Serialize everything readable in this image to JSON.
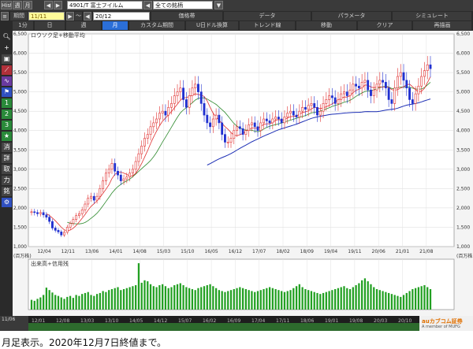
{
  "toolbar": {
    "tabs_left": [
      "Hist",
      "週",
      "月"
    ],
    "symbol": "4901/T 富士フイルム",
    "universe": "全ての銘柄",
    "col_labels": [
      "価格帯",
      "データ",
      "パラメータ",
      "シミュレート"
    ],
    "period_label": "期間",
    "period_from": "11/11",
    "period_to": "20/12",
    "period_sep": "～",
    "row3": [
      "1分",
      "日",
      "週",
      "月",
      "カスタム期間",
      "U日ドル換算",
      "トレンド線",
      "移動",
      "クリア",
      "再描画"
    ],
    "active": "月"
  },
  "sidebar": [
    "1",
    "2",
    "3",
    "★",
    "消",
    "詳",
    "取",
    "力",
    "銘"
  ],
  "chart_data": {
    "type": "candlestick",
    "title": "ロウソク足+移動平均",
    "x_ticks": [
      "12/04",
      "12/11",
      "13/06",
      "14/01",
      "14/08",
      "15/03",
      "15/10",
      "16/05",
      "16/12",
      "17/07",
      "18/02",
      "18/09",
      "19/04",
      "19/11",
      "20/06",
      "21/01",
      "21/08"
    ],
    "y_ticks": [
      "6,500",
      "6,000",
      "5,500",
      "5,000",
      "4,500",
      "4,000",
      "3,500",
      "3,000",
      "2,500",
      "2,000",
      "1,500",
      "1,000"
    ],
    "ylim": [
      1000,
      6500
    ],
    "close": [
      1900,
      1880,
      1850,
      1880,
      1820,
      1760,
      1650,
      1480,
      1420,
      1380,
      1300,
      1370,
      1500,
      1600,
      1700,
      1800,
      1850,
      1950,
      2100,
      2250,
      2300,
      2200,
      2300,
      2500,
      2700,
      2900,
      3000,
      3150,
      2950,
      2850,
      2700,
      2750,
      2800,
      2900,
      3000,
      3200,
      3400,
      3600,
      3800,
      3900,
      4100,
      4200,
      4300,
      4450,
      4500,
      4400,
      4600,
      4700,
      4900,
      5000,
      5100,
      4800,
      4600,
      4900,
      5100,
      5200,
      5000,
      4700,
      4400,
      4200,
      4100,
      4300,
      4400,
      4200,
      3900,
      3700,
      3700,
      3800,
      4000,
      4100,
      4050,
      3900,
      4000,
      4150,
      4200,
      4100,
      4000,
      4200,
      4300,
      4250,
      4200,
      4300,
      4350,
      4300,
      4200,
      4350,
      4450,
      4500,
      4400,
      4350,
      4500,
      4600,
      4550,
      4650,
      4700,
      4600,
      4400,
      4500,
      4700,
      4800,
      4900,
      4850,
      4700,
      4800,
      4950,
      5000,
      4900,
      5050,
      5200,
      5150,
      5100,
      5250,
      5300,
      5050,
      4900,
      5050,
      5200,
      5300,
      5250,
      5100,
      4800,
      4700,
      5100,
      5400,
      5500,
      5300,
      5100,
      4800,
      4700,
      4950,
      5150,
      5400,
      5550,
      5700,
      5600
    ],
    "ma_short": "6",
    "ma_long": "60",
    "volume_title": "出来高+信用残",
    "volume_unit": "(百万株)",
    "volume": [
      20,
      18,
      22,
      25,
      30,
      45,
      40,
      35,
      30,
      28,
      25,
      22,
      26,
      28,
      24,
      30,
      28,
      32,
      34,
      36,
      30,
      28,
      32,
      34,
      38,
      36,
      40,
      42,
      44,
      46,
      40,
      42,
      44,
      46,
      48,
      50,
      95,
      55,
      60,
      58,
      52,
      48,
      46,
      50,
      52,
      48,
      44,
      46,
      50,
      52,
      54,
      50,
      46,
      44,
      42,
      40,
      44,
      46,
      48,
      50,
      52,
      48,
      44,
      40,
      38,
      36,
      38,
      40,
      42,
      44,
      46,
      44,
      42,
      40,
      38,
      36,
      38,
      40,
      42,
      44,
      46,
      44,
      42,
      40,
      38,
      36,
      38,
      40,
      44,
      48,
      52,
      46,
      42,
      40,
      38,
      36,
      34,
      32,
      34,
      36,
      38,
      40,
      42,
      44,
      46,
      48,
      44,
      42,
      46,
      50,
      54,
      60,
      64,
      58,
      52,
      46,
      42,
      40,
      38,
      36,
      34,
      32,
      30,
      28,
      26,
      30,
      34,
      38,
      42,
      44,
      46,
      48,
      50,
      46,
      42
    ],
    "volume_ylim": [
      0,
      100
    ]
  },
  "timeline": {
    "left_label": "11/06",
    "ticks": [
      "12/01",
      "12/08",
      "13/03",
      "13/10",
      "14/05",
      "14/12",
      "15/07",
      "16/02",
      "16/09",
      "17/04",
      "17/11",
      "18/06",
      "19/01",
      "19/08",
      "20/03",
      "20/10"
    ],
    "brand": "auカブコム証券"
  },
  "caption": "月足表示。2020年12月7日終値まで。"
}
